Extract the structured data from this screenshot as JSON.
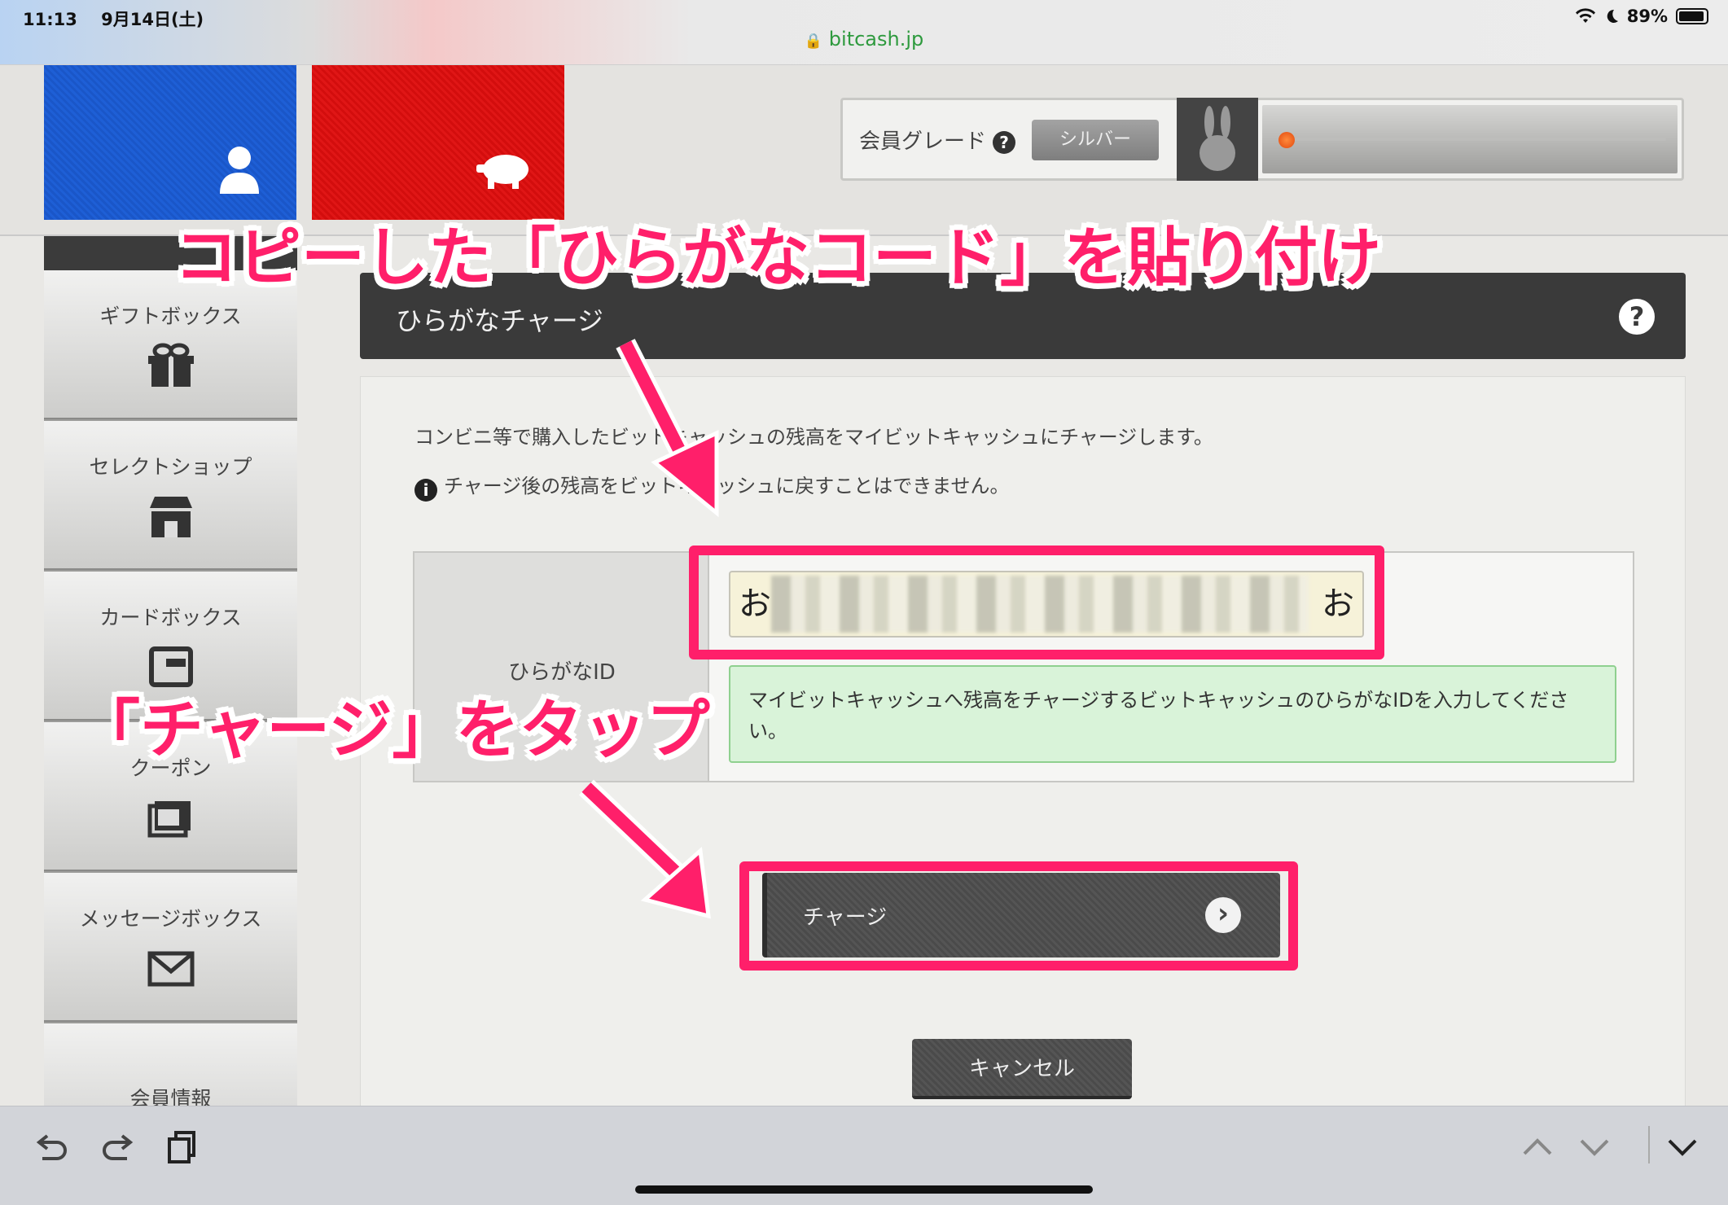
{
  "status_bar": {
    "time": "11:13",
    "date": "9月14日(土)",
    "battery": "89%"
  },
  "browser": {
    "url": "bitcash.jp"
  },
  "header": {
    "grade_label": "会員グレード",
    "grade_value": "シルバー"
  },
  "sidebar": {
    "items": [
      {
        "label": "ギフトボックス",
        "icon": "gift-icon"
      },
      {
        "label": "セレクトショップ",
        "icon": "shop-icon"
      },
      {
        "label": "カードボックス",
        "icon": "wallet-icon"
      },
      {
        "label": "クーポン",
        "icon": "coupon-icon"
      },
      {
        "label": "メッセージボックス",
        "icon": "mail-icon"
      },
      {
        "label": "会員情報",
        "icon": ""
      }
    ]
  },
  "main": {
    "title": "ひらがなチャージ",
    "description": "コンビニ等で購入したビットキャッシュの残高をマイビットキャッシュにチャージします。",
    "notice": "チャージ後の残高をビットキャッシュに戻すことはできません。",
    "form": {
      "label": "ひらがなID",
      "value_start": "お",
      "value_end": "お",
      "help": "マイビットキャッシュへ残高をチャージするビットキャッシュのひらがなIDを入力してください。"
    },
    "charge_button": "チャージ",
    "cancel_button": "キャンセル"
  },
  "annotations": {
    "paste_instruction": "コピーした「ひらがなコード」を貼り付け",
    "tap_instruction": "「チャージ」をタップ",
    "highlight_color": "#ff1f6a"
  }
}
